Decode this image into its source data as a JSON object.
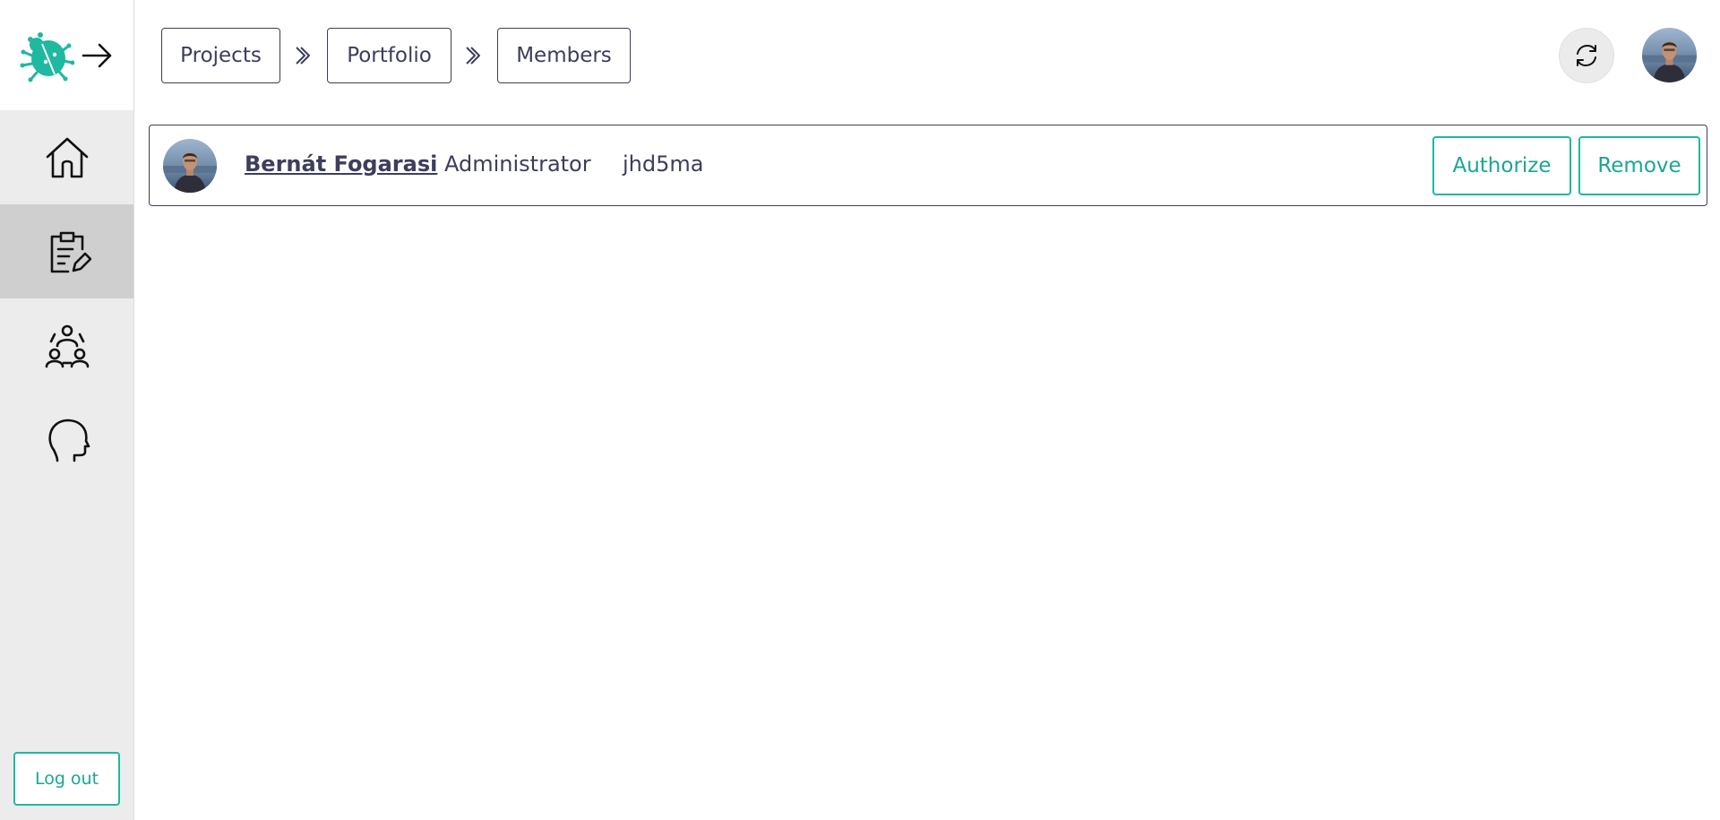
{
  "sidebar": {
    "logo_icon": "ladybug-logo-icon",
    "expand_icon": "arrow-right-icon",
    "items": [
      {
        "name": "home",
        "icon": "house-icon",
        "active": false
      },
      {
        "name": "projects",
        "icon": "clipboard-edit-icon",
        "active": true
      },
      {
        "name": "team",
        "icon": "people-group-icon",
        "active": false
      },
      {
        "name": "profile",
        "icon": "head-profile-icon",
        "active": false
      }
    ],
    "logout_label": "Log out"
  },
  "breadcrumbs": [
    {
      "label": "Projects"
    },
    {
      "label": "Portfolio"
    },
    {
      "label": "Members"
    }
  ],
  "header": {
    "refresh_icon": "refresh-icon",
    "avatar_icon": "user-avatar"
  },
  "members": [
    {
      "name": "Bernát Fogarasi",
      "role": "Administrator",
      "code": "jhd5ma",
      "authorize_label": "Authorize",
      "remove_label": "Remove"
    }
  ],
  "colors": {
    "accent": "#1fb8a0",
    "text": "#3d3d5c",
    "sidebar_bg": "#ececec",
    "active_nav_bg": "#cfcfcf"
  }
}
